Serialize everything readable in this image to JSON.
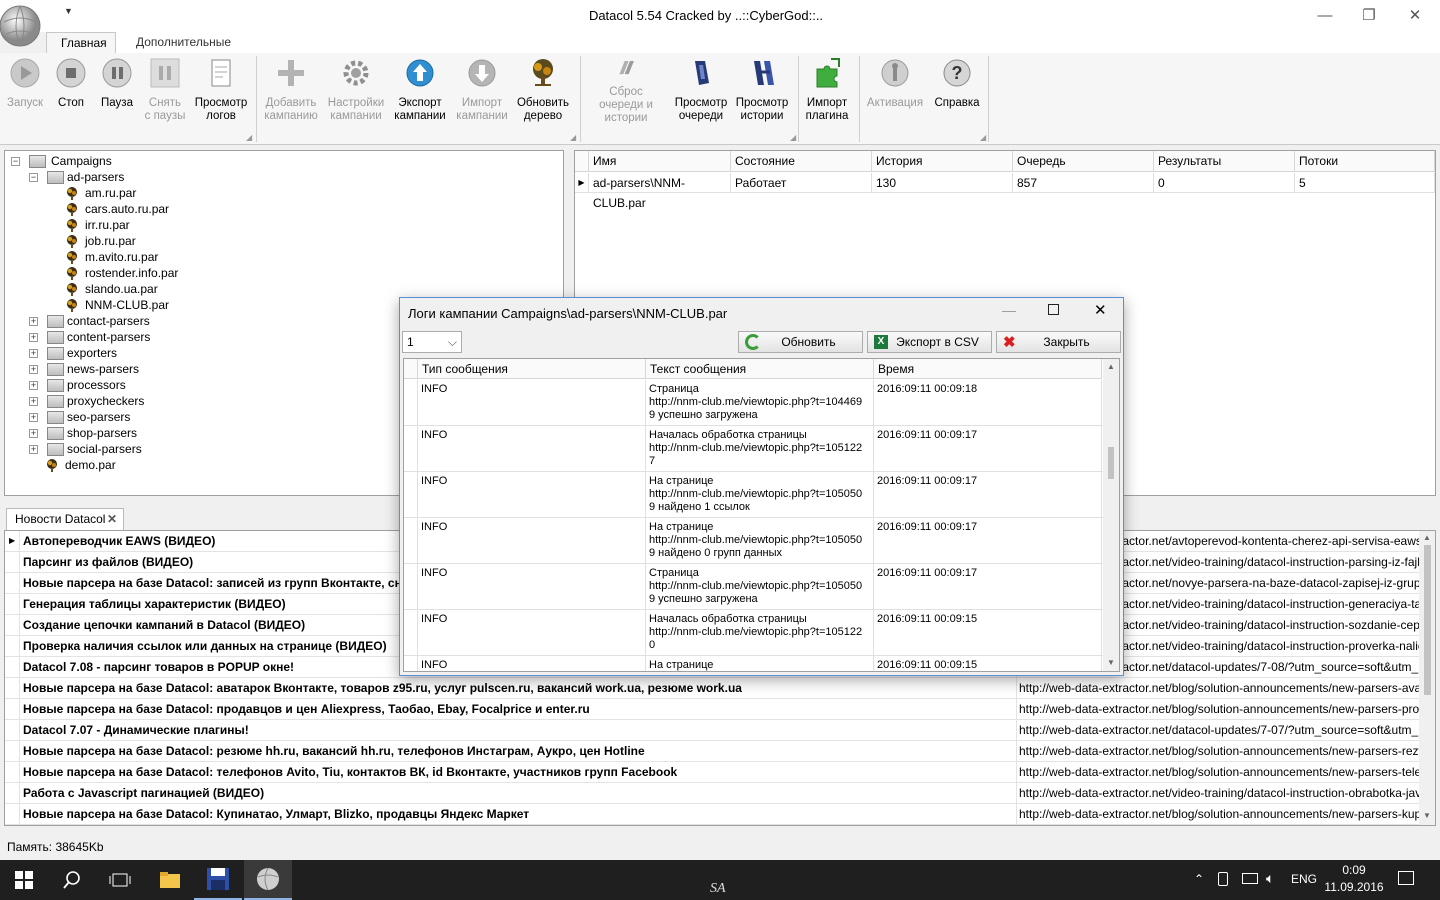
{
  "window": {
    "title": "Datacol 5.54 Cracked by ..::CyberGod::.."
  },
  "ribbon": {
    "tabs": [
      "Главная",
      "Дополнительные"
    ],
    "buttons": [
      {
        "label": "Запуск",
        "icon": "play-icon",
        "enabled": false
      },
      {
        "label": "Стоп",
        "icon": "stop-icon",
        "enabled": true
      },
      {
        "label": "Пауза",
        "icon": "pause-icon",
        "enabled": true
      },
      {
        "label": "Снять с паузы",
        "icon": "resume-icon",
        "enabled": false
      },
      {
        "label": "Просмотр логов",
        "icon": "log-icon",
        "enabled": true
      },
      {
        "label": "Добавить кампанию",
        "icon": "plus-icon",
        "enabled": false
      },
      {
        "label": "Настройки кампании",
        "icon": "gear-icon",
        "enabled": false
      },
      {
        "label": "Экспорт кампании",
        "icon": "export-icon",
        "enabled": true
      },
      {
        "label": "Импорт кампании",
        "icon": "import-icon",
        "enabled": false
      },
      {
        "label": "Обновить дерево",
        "icon": "tree-icon",
        "enabled": true
      },
      {
        "label": "Сброс очереди и истории",
        "icon": "reset-icon",
        "enabled": false
      },
      {
        "label": "Просмотр очереди",
        "icon": "queue-icon",
        "enabled": true
      },
      {
        "label": "Просмотр истории",
        "icon": "history-icon",
        "enabled": true
      },
      {
        "label": "Импорт плагина",
        "icon": "plugin-icon",
        "enabled": true
      },
      {
        "label": "Активация",
        "icon": "key-icon",
        "enabled": false
      },
      {
        "label": "Справка",
        "icon": "help-icon",
        "enabled": true
      }
    ]
  },
  "tree": {
    "root": "Campaigns",
    "open_folder": "ad-parsers",
    "open_children": [
      "am.ru.par",
      "cars.auto.ru.par",
      "irr.ru.par",
      "job.ru.par",
      "m.avito.ru.par",
      "rostender.info.par",
      "slando.ua.par",
      "NNM-CLUB.par"
    ],
    "folders": [
      "contact-parsers",
      "content-parsers",
      "exporters",
      "news-parsers",
      "processors",
      "proxycheckers",
      "seo-parsers",
      "shop-parsers",
      "social-parsers"
    ],
    "file": "demo.par"
  },
  "campaigns": {
    "columns": [
      "Имя",
      "Состояние",
      "История",
      "Очередь",
      "Результаты",
      "Потоки"
    ],
    "rows": [
      [
        "ad-parsers\\NNM-CLUB.par",
        "Работает",
        "130",
        "857",
        "0",
        "5"
      ]
    ]
  },
  "news": {
    "tab": "Новости Datacol",
    "rows": [
      {
        "title": "Автопереводчик EAWS (ВИДЕО)",
        "url": "http://web-data-extractor.net/avtoperevod-kontenta-cherez-api-servisa-eaws..."
      },
      {
        "title": "Парсинг из файлов (ВИДЕО)",
        "url": "http://web-data-extractor.net/video-training/datacol-instruction-parsing-iz-fajl..."
      },
      {
        "title": "Новые парсера на базе Datacol: записей из групп Вконтакте, снимков Instagram",
        "url": "http://web-data-extractor.net/novye-parsera-na-baze-datacol-zapisej-iz-grup..."
      },
      {
        "title": "Генерация таблицы характеристик (ВИДЕО)",
        "url": "http://web-data-extractor.net/video-training/datacol-instruction-generaciya-ta..."
      },
      {
        "title": "Создание цепочки кампаний в Datacol (ВИДЕО)",
        "url": "http://web-data-extractor.net/video-training/datacol-instruction-sozdanie-cep..."
      },
      {
        "title": "Проверка наличия ссылок или данных на странице (ВИДЕО)",
        "url": "http://web-data-extractor.net/video-training/datacol-instruction-proverka-nalic..."
      },
      {
        "title": "Datacol 7.08 - парсинг товаров в POPUP окне!",
        "url": "http://web-data-extractor.net/datacol-updates/7-08/?utm_source=soft&utm_..."
      },
      {
        "title": "Новые парсера на базе Datacol: аватарок Вконтакте, товаров z95.ru, услуг pulscen.ru, вакансий work.ua, резюме work.ua",
        "url": "http://web-data-extractor.net/blog/solution-announcements/new-parsers-avat..."
      },
      {
        "title": "Новые парсера на базе Datacol: продавцов и цен Aliexpress, Таобао, Ebay, Focalprice и enter.ru",
        "url": "http://web-data-extractor.net/blog/solution-announcements/new-parsers-prod..."
      },
      {
        "title": "Datacol 7.07 - Динамические плагины!",
        "url": "http://web-data-extractor.net/datacol-updates/7-07/?utm_source=soft&utm_..."
      },
      {
        "title": "Новые парсера на базе Datacol: резюме hh.ru, вакансий hh.ru, телефонов Инстаграм, Аукро, цен Hotline",
        "url": "http://web-data-extractor.net/blog/solution-announcements/new-parsers-rezy..."
      },
      {
        "title": "Новые парсера на базе Datacol: телефонов Avito, Tiu, контактов ВК, id Вконтакте, участников групп Facebook",
        "url": "http://web-data-extractor.net/blog/solution-announcements/new-parsers-tele..."
      },
      {
        "title": "Работа с Javascript пагинацией (ВИДЕО)",
        "url": "http://web-data-extractor.net/video-training/datacol-instruction-obrabotka-jav..."
      },
      {
        "title": "Новые парсера на базе Datacol: Купинатао, Улмарт, Blizko, продавцы Яндекс Маркет",
        "url": "http://web-data-extractor.net/blog/solution-announcements/new-parsers-kupi..."
      }
    ]
  },
  "status": {
    "memory": "Память: 38645Kb"
  },
  "dialog": {
    "title": "Логи кампании Campaigns\\ad-parsers\\NNM-CLUB.par",
    "select_value": "1",
    "refresh": "Обновить",
    "export": "Экспорт в CSV",
    "close": "Закрыть",
    "columns": [
      "Тип сообщения",
      "Текст сообщения",
      "Время"
    ],
    "rows": [
      {
        "type": "INFO",
        "text": "Страница\nhttp://nnm-club.me/viewtopic.php?t=104469\n9 успешно загружена",
        "time": "2016:09:11 00:09:18"
      },
      {
        "type": "INFO",
        "text": "Началась обработка страницы\nhttp://nnm-club.me/viewtopic.php?t=105122\n7",
        "time": "2016:09:11 00:09:17"
      },
      {
        "type": "INFO",
        "text": "На странице\nhttp://nnm-club.me/viewtopic.php?t=105050\n9 найдено 1 ссылок",
        "time": "2016:09:11 00:09:17"
      },
      {
        "type": "INFO",
        "text": "На странице\nhttp://nnm-club.me/viewtopic.php?t=105050\n9 найдено 0 групп данных",
        "time": "2016:09:11 00:09:17"
      },
      {
        "type": "INFO",
        "text": "Страница\nhttp://nnm-club.me/viewtopic.php?t=105050\n9 успешно загружена",
        "time": "2016:09:11 00:09:17"
      },
      {
        "type": "INFO",
        "text": "Началась обработка страницы\nhttp://nnm-club.me/viewtopic.php?t=105122\n0",
        "time": "2016:09:11 00:09:15"
      },
      {
        "type": "INFO",
        "text": "На странице",
        "time": "2016:09:11 00:09:15"
      }
    ]
  },
  "taskbar": {
    "lang": "ENG",
    "time": "0:09",
    "date": "11.09.2016",
    "center": "SA"
  }
}
